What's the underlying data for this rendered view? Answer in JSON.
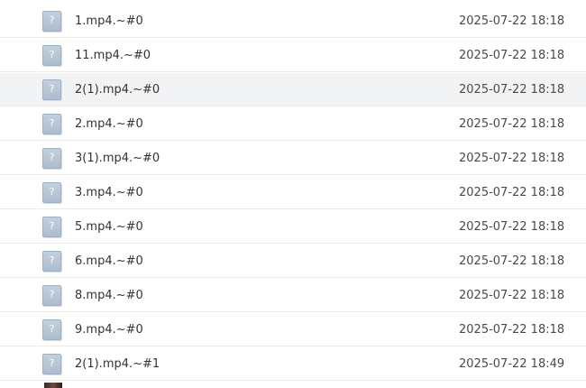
{
  "files": [
    {
      "name": "1.mp4.~#0",
      "date": "2025-07-22 18:18",
      "icon": "unknown-file-icon",
      "glyph": "?"
    },
    {
      "name": "11.mp4.~#0",
      "date": "2025-07-22 18:18",
      "icon": "unknown-file-icon",
      "glyph": "?"
    },
    {
      "name": "2(1).mp4.~#0",
      "date": "2025-07-22 18:18",
      "icon": "unknown-file-icon",
      "glyph": "?",
      "hovered": true
    },
    {
      "name": "2.mp4.~#0",
      "date": "2025-07-22 18:18",
      "icon": "unknown-file-icon",
      "glyph": "?"
    },
    {
      "name": "3(1).mp4.~#0",
      "date": "2025-07-22 18:18",
      "icon": "unknown-file-icon",
      "glyph": "?"
    },
    {
      "name": "3.mp4.~#0",
      "date": "2025-07-22 18:18",
      "icon": "unknown-file-icon",
      "glyph": "?"
    },
    {
      "name": "5.mp4.~#0",
      "date": "2025-07-22 18:18",
      "icon": "unknown-file-icon",
      "glyph": "?"
    },
    {
      "name": "6.mp4.~#0",
      "date": "2025-07-22 18:18",
      "icon": "unknown-file-icon",
      "glyph": "?"
    },
    {
      "name": "8.mp4.~#0",
      "date": "2025-07-22 18:18",
      "icon": "unknown-file-icon",
      "glyph": "?"
    },
    {
      "name": "9.mp4.~#0",
      "date": "2025-07-22 18:18",
      "icon": "unknown-file-icon",
      "glyph": "?"
    },
    {
      "name": "2(1).mp4.~#1",
      "date": "2025-07-22 18:49",
      "icon": "unknown-file-icon",
      "glyph": "?"
    }
  ],
  "colors": {
    "hover_background": "#f2f3f5",
    "row_divider": "#ebebeb",
    "icon_fill": "#aebdcd",
    "text": "#333333"
  }
}
